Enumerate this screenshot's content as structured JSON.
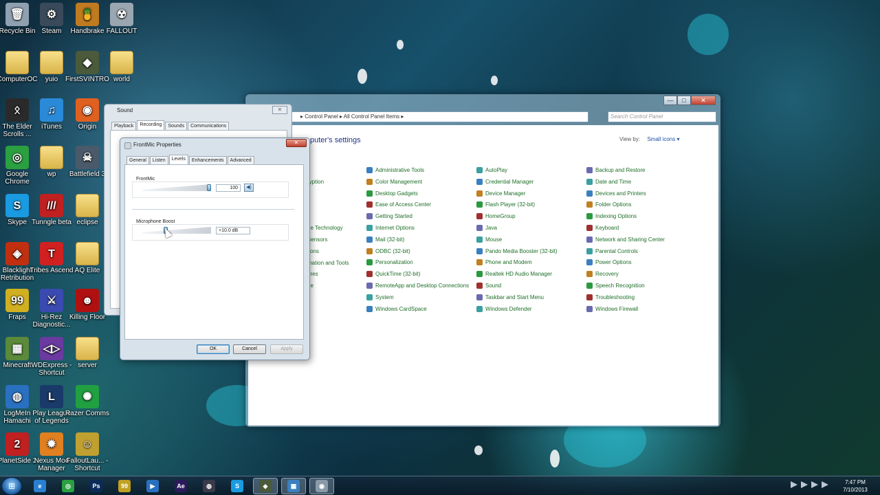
{
  "desktop": {
    "icons": [
      {
        "label": "Recycle Bin",
        "glyph": "🗑",
        "color": "#8fa0b0"
      },
      {
        "label": "Steam",
        "glyph": "⚙",
        "color": "#3a4a5a"
      },
      {
        "label": "Handbrake",
        "glyph": "🍍",
        "color": "#c07a20"
      },
      {
        "label": "FALLOUT",
        "glyph": "☢",
        "color": "#9aa6b0"
      },
      {
        "label": "ComputerOC",
        "glyph": "",
        "color": "folder"
      },
      {
        "label": "yuio",
        "glyph": "",
        "color": "folder"
      },
      {
        "label": "FirstSVINTRO",
        "glyph": "◆",
        "color": "#4a5a3a"
      },
      {
        "label": "world",
        "glyph": "",
        "color": "folder"
      },
      {
        "label": "The Elder Scrolls ...",
        "glyph": "ᛟ",
        "color": "#2a2a2a"
      },
      {
        "label": "iTunes",
        "glyph": "♫",
        "color": "#2a8ad8"
      },
      {
        "label": "Origin",
        "glyph": "◉",
        "color": "#e06020"
      },
      {
        "label": "Google Chrome",
        "glyph": "◎",
        "color": "#2aa040"
      },
      {
        "label": "wp",
        "glyph": "",
        "color": "folder"
      },
      {
        "label": "Battlefield 3",
        "glyph": "☠",
        "color": "#4a5a6a"
      },
      {
        "label": "Skype",
        "glyph": "S",
        "color": "#1a9ae0"
      },
      {
        "label": "Tunngle beta",
        "glyph": "///",
        "color": "#c02020"
      },
      {
        "label": "eclipse",
        "glyph": "",
        "color": "folder"
      },
      {
        "label": "Blacklight Retribution",
        "glyph": "◈",
        "color": "#c03010"
      },
      {
        "label": "Tribes Ascend",
        "glyph": "T",
        "color": "#d02020"
      },
      {
        "label": "AQ Elite",
        "glyph": "",
        "color": "folder"
      },
      {
        "label": "Fraps",
        "glyph": "99",
        "color": "#d0b020"
      },
      {
        "label": "Hi-Rez Diagnostic...",
        "glyph": "⚔",
        "color": "#3a4ab0"
      },
      {
        "label": "Killing Floor",
        "glyph": "☻",
        "color": "#b01010"
      },
      {
        "label": "Minecraft",
        "glyph": "▦",
        "color": "#5a8a3a"
      },
      {
        "label": "WDExpress - Shortcut",
        "glyph": "◁▷",
        "color": "#6a3aa0"
      },
      {
        "label": "server",
        "glyph": "",
        "color": "folder"
      },
      {
        "label": "LogMeIn Hamachi",
        "glyph": "◍",
        "color": "#2a70c0"
      },
      {
        "label": "Play League of Legends",
        "glyph": "L",
        "color": "#1a3a6a"
      },
      {
        "label": "Razer Comms",
        "glyph": "✺",
        "color": "#20a040"
      },
      {
        "label": "PlanetSide 2",
        "glyph": "2",
        "color": "#c02020"
      },
      {
        "label": "Nexus Mod Manager",
        "glyph": "✹",
        "color": "#e08020"
      },
      {
        "label": "FalloutLau... - Shortcut",
        "glyph": "☺",
        "color": "#c0a030"
      }
    ]
  },
  "control_panel": {
    "address": {
      "crumb1": "Control Panel",
      "crumb2": "All Control Panel Items"
    },
    "search_placeholder": "Search Control Panel",
    "heading": "puter's settings",
    "view_by_label": "View by:",
    "view_by_value": "Small icons ▾",
    "left_column_partial": [
      "ryption",
      "ge Technology",
      "Sensors",
      "cons",
      "mation and Tools",
      "ures",
      "ge"
    ],
    "columns": [
      [
        "Administrative Tools",
        "Color Management",
        "Desktop Gadgets",
        "Ease of Access Center",
        "Getting Started",
        "Internet Options",
        "Mail (32-bit)",
        "ODBC (32-bit)",
        "Personalization",
        "QuickTime (32-bit)",
        "RemoteApp and Desktop Connections",
        "System",
        "Windows CardSpace"
      ],
      [
        "AutoPlay",
        "Credential Manager",
        "Device Manager",
        "Flash Player (32-bit)",
        "HomeGroup",
        "Java",
        "Mouse",
        "Pando Media Booster (32-bit)",
        "Phone and Modem",
        "Realtek HD Audio Manager",
        "Sound",
        "Taskbar and Start Menu",
        "Windows Defender"
      ],
      [
        "Backup and Restore",
        "Date and Time",
        "Devices and Printers",
        "Folder Options",
        "Indexing Options",
        "Keyboard",
        "Network and Sharing Center",
        "Parental Controls",
        "Power Options",
        "Recovery",
        "Speech Recognition",
        "Troubleshooting",
        "Windows Firewall"
      ]
    ]
  },
  "sound_dialog": {
    "title": "Sound",
    "close": "✕",
    "tabs": [
      "Playback",
      "Recording",
      "Sounds",
      "Communications"
    ]
  },
  "frontmic_dialog": {
    "title": "FrontMic Properties",
    "close": "✕",
    "tabs": [
      "General",
      "Listen",
      "Levels",
      "Enhancements",
      "Advanced"
    ],
    "frontmic": {
      "label": "FrontMic",
      "value": "100",
      "level_fraction": 1.0
    },
    "boost": {
      "label": "Microphone Boost",
      "value": "+10.0 dB",
      "level_fraction": 0.33
    },
    "buttons": {
      "ok": "OK",
      "cancel": "Cancel",
      "apply": "Apply"
    }
  },
  "taskbar": {
    "start": "⊞",
    "apps": [
      {
        "name": "ie",
        "glyph": "e",
        "color": "#2a80d0",
        "open": false
      },
      {
        "name": "chrome",
        "glyph": "◎",
        "color": "#2aa040",
        "open": false
      },
      {
        "name": "photoshop",
        "glyph": "Ps",
        "color": "#0a2a5a",
        "open": false
      },
      {
        "name": "fraps",
        "glyph": "99",
        "color": "#c0a020",
        "open": false
      },
      {
        "name": "media",
        "glyph": "▶",
        "color": "#2a70c0",
        "open": false
      },
      {
        "name": "aftereffects",
        "glyph": "Ae",
        "color": "#2a1a5a",
        "open": false
      },
      {
        "name": "obs",
        "glyph": "◍",
        "color": "#3a3a4a",
        "open": false
      },
      {
        "name": "skype",
        "glyph": "S",
        "color": "#1a9ae0",
        "open": false
      },
      {
        "name": "app",
        "glyph": "◈",
        "color": "#4a5a3a",
        "open": true
      },
      {
        "name": "controlpanel",
        "glyph": "▦",
        "color": "#3a80c0",
        "open": true
      },
      {
        "name": "sound",
        "glyph": "◉",
        "color": "#8a9aa8",
        "open": true
      }
    ],
    "time": "7:47 PM",
    "date": "7/10/2013"
  }
}
